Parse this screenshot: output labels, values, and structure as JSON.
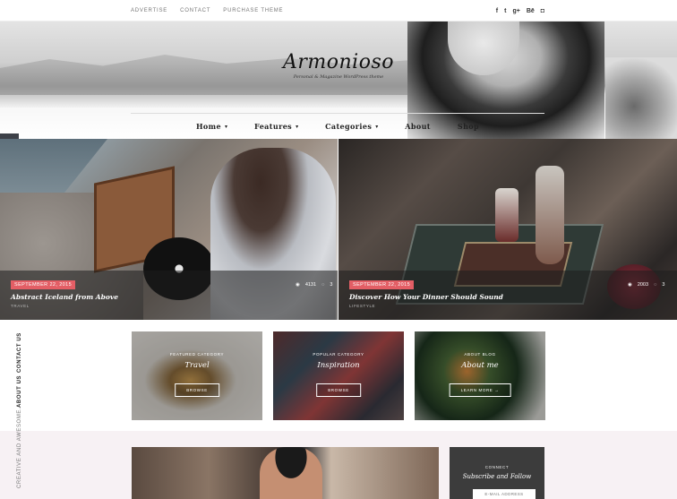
{
  "topbar": {
    "links": [
      "ADVERTISE",
      "CONTACT",
      "PURCHASE THEME"
    ],
    "social_icons": [
      {
        "name": "facebook-icon",
        "glyph": "f"
      },
      {
        "name": "twitter-icon",
        "glyph": "t"
      },
      {
        "name": "google-plus-icon",
        "glyph": "g+"
      },
      {
        "name": "behance-icon",
        "glyph": "Bē"
      },
      {
        "name": "instagram-icon",
        "glyph": "◘"
      }
    ]
  },
  "header": {
    "logo": "Armonioso",
    "tagline": "Personal & Magazine WordPress theme"
  },
  "nav": [
    {
      "label": "Home",
      "has_dropdown": true
    },
    {
      "label": "Features",
      "has_dropdown": true
    },
    {
      "label": "Categories",
      "has_dropdown": true
    },
    {
      "label": "About",
      "has_dropdown": false
    },
    {
      "label": "Shop",
      "has_dropdown": false
    }
  ],
  "styles_widget": {
    "label": "Styles",
    "icon": "sliders-icon"
  },
  "slides": [
    {
      "date": "SEPTEMBER 22, 2015",
      "title": "Abstract Iceland from Above",
      "category": "TRAVEL",
      "views": "4131",
      "comments": "3"
    },
    {
      "date": "SEPTEMBER 22, 2015",
      "title": "Discover How Your Dinner Should Sound",
      "category": "LIFESTYLE",
      "views": "2003",
      "comments": "3"
    }
  ],
  "side_text": {
    "contact": "CONTACT US",
    "about": "ABOUT US",
    "creative": "CREATIVE AND AWESOME."
  },
  "promos": [
    {
      "kicker": "FEATURED CATEGORY",
      "name": "Travel",
      "button": "BROWSE"
    },
    {
      "kicker": "POPULAR CATEGORY",
      "name": "Inspiration",
      "button": "BROWSE"
    },
    {
      "kicker": "ABOUT BLOG",
      "name": "About me",
      "button": "LEARN MORE →"
    }
  ],
  "subscribe": {
    "kicker": "CONNECT",
    "title": "Subscribe and Follow",
    "placeholder": "E-MAIL ADDRESS"
  },
  "colors": {
    "accent": "#e35e65",
    "dark": "#3c3c3c",
    "band": "#f7f1f4"
  }
}
